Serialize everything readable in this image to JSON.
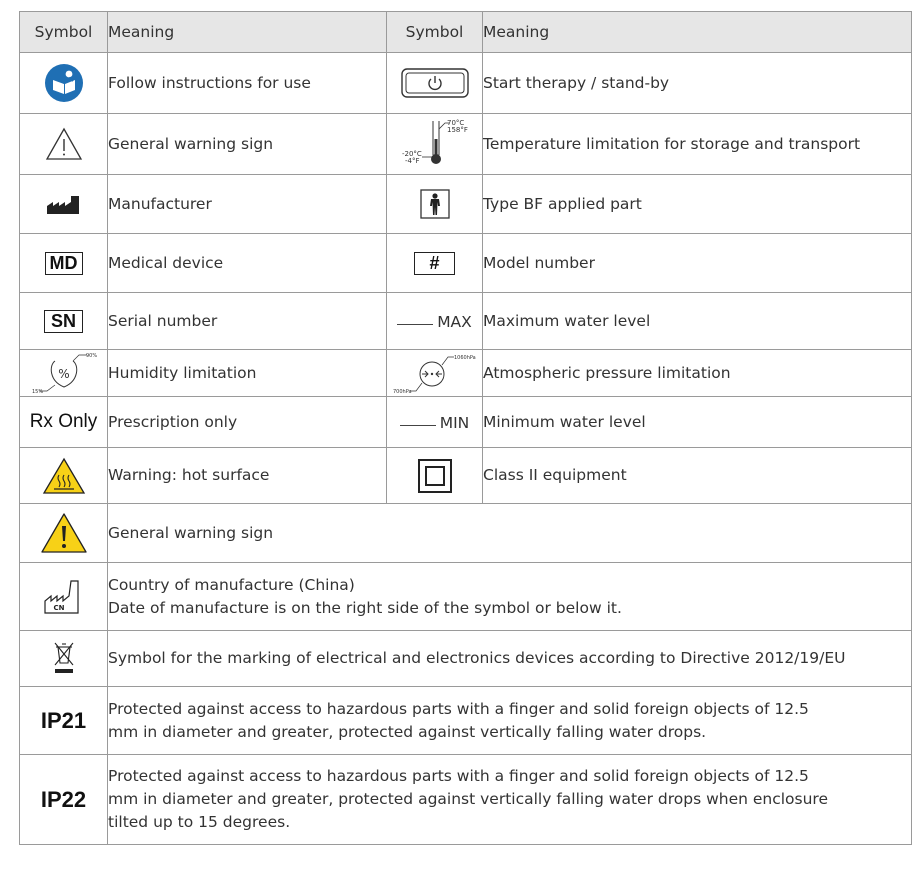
{
  "headers": {
    "symbol": "Symbol",
    "meaning": "Meaning"
  },
  "rows": [
    {
      "left": {
        "symbol": "manual-icon",
        "meaning": "Follow instructions for use"
      },
      "right": {
        "symbol": "power-button-icon",
        "meaning": "Start therapy / stand-by"
      }
    },
    {
      "left": {
        "symbol": "warning-outline-icon",
        "meaning": "General warning sign"
      },
      "right": {
        "symbol": "thermometer-icon",
        "meaning": "Temperature limitation for storage and transport",
        "labels": {
          "high_c": "70°C",
          "high_f": "158°F",
          "low_c": "-20°C",
          "low_f": "-4°F"
        }
      }
    },
    {
      "left": {
        "symbol": "factory-icon",
        "meaning": "Manufacturer"
      },
      "right": {
        "symbol": "person-bf-icon",
        "meaning": "Type BF applied part"
      }
    },
    {
      "left": {
        "symbol_text": "MD",
        "meaning": "Medical device"
      },
      "right": {
        "symbol_text": "#",
        "meaning": "Model number"
      }
    },
    {
      "left": {
        "symbol_text": "SN",
        "meaning": "Serial number"
      },
      "right": {
        "symbol_text": "MAX",
        "meaning": "Maximum water level"
      }
    },
    {
      "left": {
        "symbol": "humidity-icon",
        "meaning": "Humidity limitation",
        "labels": {
          "high": "90%",
          "low": "15%"
        }
      },
      "right": {
        "symbol": "pressure-icon",
        "meaning": "Atmospheric pressure limitation",
        "labels": {
          "high": "1060hPa",
          "low": "700hPa"
        }
      }
    },
    {
      "left": {
        "symbol_text": "Rx Only",
        "meaning": "Prescription only"
      },
      "right": {
        "symbol_text": "MIN",
        "meaning": "Minimum water level"
      }
    },
    {
      "left": {
        "symbol": "hot-surface-icon",
        "meaning": "Warning: hot surface"
      },
      "right": {
        "symbol": "class-ii-icon",
        "meaning": "Class II equipment"
      }
    },
    {
      "full": {
        "symbol": "warning-yellow-icon",
        "meaning": "General warning sign"
      }
    },
    {
      "full": {
        "symbol": "country-factory-icon",
        "symbol_text": "CN",
        "meaning": "Country of manufacture (China)\nDate of manufacture is on the right side of the symbol or below it."
      }
    },
    {
      "full": {
        "symbol": "weee-bin-icon",
        "meaning": "Symbol for the marking of electrical and electronics devices according to Directive 2012/19/EU"
      }
    },
    {
      "full": {
        "symbol_text": "IP21",
        "meaning": "Protected against access to hazardous parts with a finger and solid foreign objects of 12.5\nmm in diameter and greater, protected against vertically falling water drops."
      }
    },
    {
      "full": {
        "symbol_text": "IP22",
        "meaning": "Protected against access to hazardous parts with a finger and solid foreign objects of 12.5\nmm in diameter and greater, protected against vertically falling water drops when enclosure\ntilted up to 15 degrees."
      }
    }
  ],
  "colors": {
    "header_bg": "#e6e6e6",
    "border": "#9a9a9a",
    "info_blue": "#1f6fb4",
    "warning_yellow": "#f7d117"
  }
}
